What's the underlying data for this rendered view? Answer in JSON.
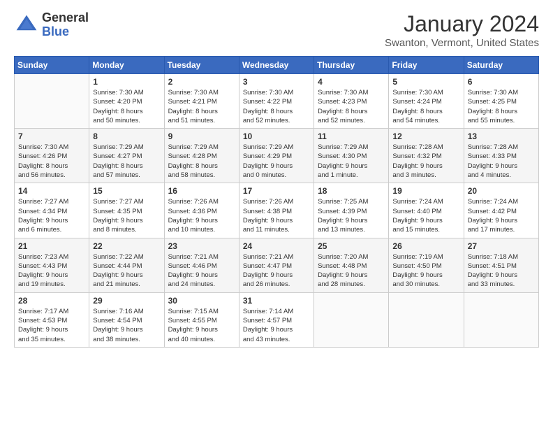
{
  "logo": {
    "general": "General",
    "blue": "Blue"
  },
  "title": "January 2024",
  "location": "Swanton, Vermont, United States",
  "days_of_week": [
    "Sunday",
    "Monday",
    "Tuesday",
    "Wednesday",
    "Thursday",
    "Friday",
    "Saturday"
  ],
  "weeks": [
    [
      {
        "day": "",
        "content": ""
      },
      {
        "day": "1",
        "content": "Sunrise: 7:30 AM\nSunset: 4:20 PM\nDaylight: 8 hours\nand 50 minutes."
      },
      {
        "day": "2",
        "content": "Sunrise: 7:30 AM\nSunset: 4:21 PM\nDaylight: 8 hours\nand 51 minutes."
      },
      {
        "day": "3",
        "content": "Sunrise: 7:30 AM\nSunset: 4:22 PM\nDaylight: 8 hours\nand 52 minutes."
      },
      {
        "day": "4",
        "content": "Sunrise: 7:30 AM\nSunset: 4:23 PM\nDaylight: 8 hours\nand 52 minutes."
      },
      {
        "day": "5",
        "content": "Sunrise: 7:30 AM\nSunset: 4:24 PM\nDaylight: 8 hours\nand 54 minutes."
      },
      {
        "day": "6",
        "content": "Sunrise: 7:30 AM\nSunset: 4:25 PM\nDaylight: 8 hours\nand 55 minutes."
      }
    ],
    [
      {
        "day": "7",
        "content": "Sunrise: 7:30 AM\nSunset: 4:26 PM\nDaylight: 8 hours\nand 56 minutes."
      },
      {
        "day": "8",
        "content": "Sunrise: 7:29 AM\nSunset: 4:27 PM\nDaylight: 8 hours\nand 57 minutes."
      },
      {
        "day": "9",
        "content": "Sunrise: 7:29 AM\nSunset: 4:28 PM\nDaylight: 8 hours\nand 58 minutes."
      },
      {
        "day": "10",
        "content": "Sunrise: 7:29 AM\nSunset: 4:29 PM\nDaylight: 9 hours\nand 0 minutes."
      },
      {
        "day": "11",
        "content": "Sunrise: 7:29 AM\nSunset: 4:30 PM\nDaylight: 9 hours\nand 1 minute."
      },
      {
        "day": "12",
        "content": "Sunrise: 7:28 AM\nSunset: 4:32 PM\nDaylight: 9 hours\nand 3 minutes."
      },
      {
        "day": "13",
        "content": "Sunrise: 7:28 AM\nSunset: 4:33 PM\nDaylight: 9 hours\nand 4 minutes."
      }
    ],
    [
      {
        "day": "14",
        "content": "Sunrise: 7:27 AM\nSunset: 4:34 PM\nDaylight: 9 hours\nand 6 minutes."
      },
      {
        "day": "15",
        "content": "Sunrise: 7:27 AM\nSunset: 4:35 PM\nDaylight: 9 hours\nand 8 minutes."
      },
      {
        "day": "16",
        "content": "Sunrise: 7:26 AM\nSunset: 4:36 PM\nDaylight: 9 hours\nand 10 minutes."
      },
      {
        "day": "17",
        "content": "Sunrise: 7:26 AM\nSunset: 4:38 PM\nDaylight: 9 hours\nand 11 minutes."
      },
      {
        "day": "18",
        "content": "Sunrise: 7:25 AM\nSunset: 4:39 PM\nDaylight: 9 hours\nand 13 minutes."
      },
      {
        "day": "19",
        "content": "Sunrise: 7:24 AM\nSunset: 4:40 PM\nDaylight: 9 hours\nand 15 minutes."
      },
      {
        "day": "20",
        "content": "Sunrise: 7:24 AM\nSunset: 4:42 PM\nDaylight: 9 hours\nand 17 minutes."
      }
    ],
    [
      {
        "day": "21",
        "content": "Sunrise: 7:23 AM\nSunset: 4:43 PM\nDaylight: 9 hours\nand 19 minutes."
      },
      {
        "day": "22",
        "content": "Sunrise: 7:22 AM\nSunset: 4:44 PM\nDaylight: 9 hours\nand 21 minutes."
      },
      {
        "day": "23",
        "content": "Sunrise: 7:21 AM\nSunset: 4:46 PM\nDaylight: 9 hours\nand 24 minutes."
      },
      {
        "day": "24",
        "content": "Sunrise: 7:21 AM\nSunset: 4:47 PM\nDaylight: 9 hours\nand 26 minutes."
      },
      {
        "day": "25",
        "content": "Sunrise: 7:20 AM\nSunset: 4:48 PM\nDaylight: 9 hours\nand 28 minutes."
      },
      {
        "day": "26",
        "content": "Sunrise: 7:19 AM\nSunset: 4:50 PM\nDaylight: 9 hours\nand 30 minutes."
      },
      {
        "day": "27",
        "content": "Sunrise: 7:18 AM\nSunset: 4:51 PM\nDaylight: 9 hours\nand 33 minutes."
      }
    ],
    [
      {
        "day": "28",
        "content": "Sunrise: 7:17 AM\nSunset: 4:53 PM\nDaylight: 9 hours\nand 35 minutes."
      },
      {
        "day": "29",
        "content": "Sunrise: 7:16 AM\nSunset: 4:54 PM\nDaylight: 9 hours\nand 38 minutes."
      },
      {
        "day": "30",
        "content": "Sunrise: 7:15 AM\nSunset: 4:55 PM\nDaylight: 9 hours\nand 40 minutes."
      },
      {
        "day": "31",
        "content": "Sunrise: 7:14 AM\nSunset: 4:57 PM\nDaylight: 9 hours\nand 43 minutes."
      },
      {
        "day": "",
        "content": ""
      },
      {
        "day": "",
        "content": ""
      },
      {
        "day": "",
        "content": ""
      }
    ]
  ]
}
